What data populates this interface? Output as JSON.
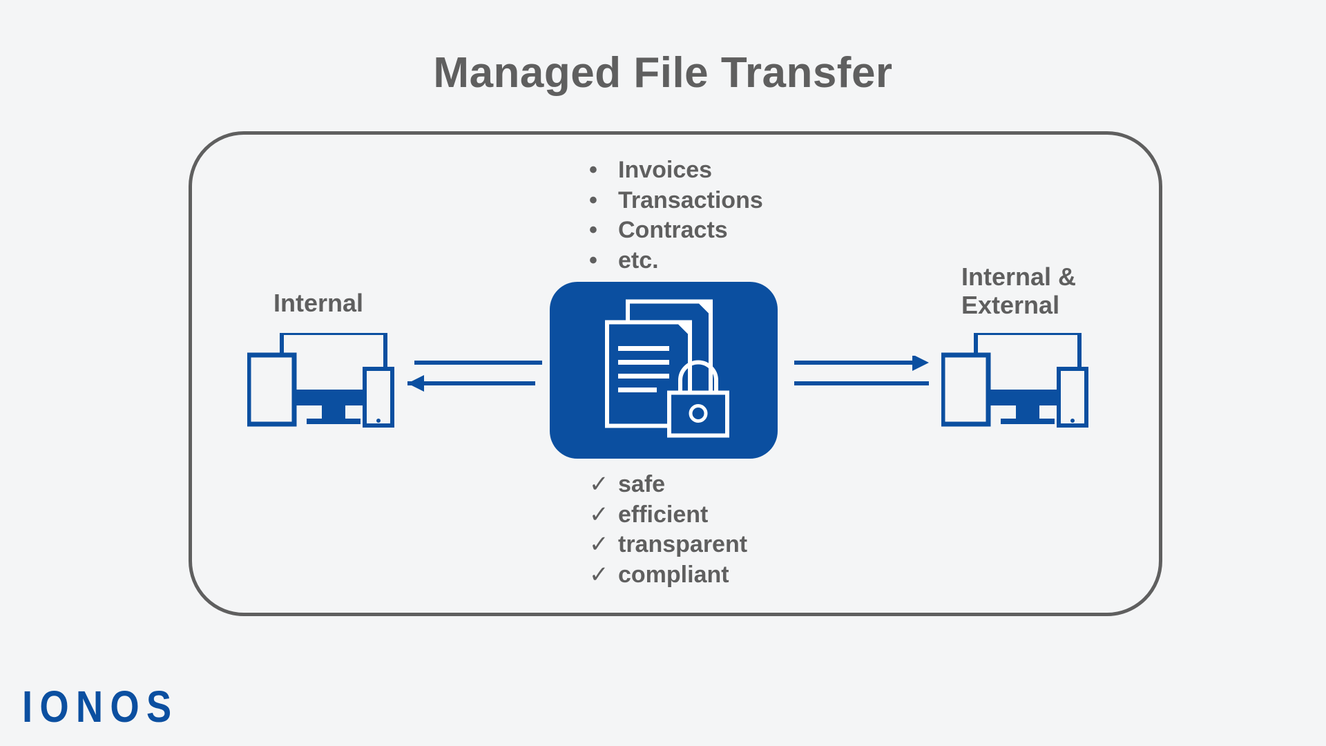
{
  "title": "Managed File Transfer",
  "left_label": "Internal",
  "right_label": "Internal &\nExternal",
  "file_types": [
    "Invoices",
    "Transactions",
    "Contracts",
    "etc."
  ],
  "qualities": [
    "safe",
    "efficient",
    "transparent",
    "compliant"
  ],
  "logo_text": "IONOS",
  "colors": {
    "brand": "#0b4fa0",
    "text": "#5f5f5f"
  }
}
